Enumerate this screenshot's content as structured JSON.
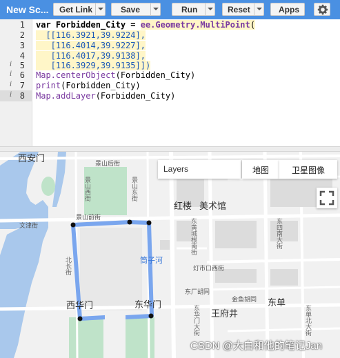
{
  "toolbar": {
    "title": "New Sc...",
    "get_link": "Get Link",
    "save": "Save",
    "run": "Run",
    "reset": "Reset",
    "apps": "Apps"
  },
  "editor": {
    "line_numbers": [
      "1",
      "2",
      "3",
      "4",
      "5",
      "6",
      "7",
      "8"
    ],
    "lines": {
      "l1_kw": "var",
      "l1_name": " Forbidden_City = ",
      "l1_fn": "ee.Geometry.MultiPoint",
      "l1_end": "(",
      "l2": "  [[116.3921,39.9224],",
      "l3": "   [116.4014,39.9227],",
      "l4": "   [116.4017,39.9138],",
      "l5": "   [116.3929,39.9135]])",
      "l6_fn": "Map.centerObject",
      "l6_rest": "(Forbidden_City)",
      "l7_fn": "print",
      "l7_rest": "(Forbidden_City)",
      "l8_fn": "Map.addLayer",
      "l8_rest": "(Forbidden_City)"
    }
  },
  "map": {
    "layers_label": "Layers",
    "map_button": "地图",
    "satellite_button": "卫星图像",
    "labels": {
      "xianyue": "西安门",
      "jingshan_front": "景山前街",
      "jingshan_west": "景山西街",
      "jingshan_east": "景山东街",
      "jingshan_back": "景山后街",
      "wenjin": "文津街",
      "beichang": "北长街",
      "hongmen": "红楼",
      "meishuguan": "美术馆",
      "tongzihe": "筒子河",
      "xihuamen": "西华门",
      "donghuamen": "东华门",
      "wangfujing": "王府井",
      "dongdan": "东单",
      "jinyu": "金鱼胡同",
      "dengshikou": "灯市口西街",
      "dongsi": "东四南大街",
      "dongchang": "东厂胡同",
      "dongcheng_e": "东黄城根南街",
      "dongzhanghe": "东华门大街",
      "dongdan_bei": "东单北大街"
    }
  },
  "watermark": "CSDN @大白和他的笔记Jan",
  "colors": {
    "toolbar": "#4a90e2",
    "polygon": "#7aa6ee",
    "water": "#a9c8ec",
    "park": "#bfe3c9"
  }
}
